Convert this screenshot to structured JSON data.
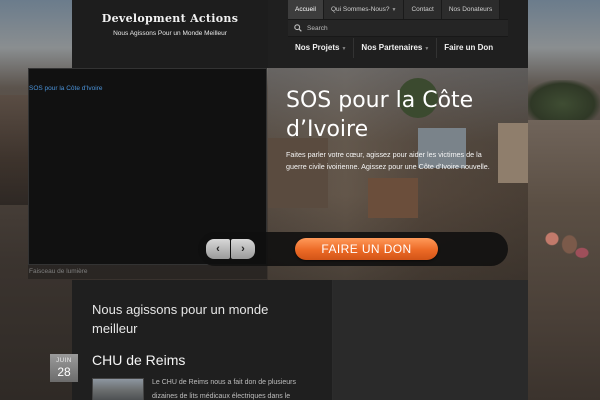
{
  "site": {
    "title": "Development Actions",
    "tagline": "Nous Agissons Pour un Monde Meilleur"
  },
  "top_menu": {
    "items": [
      {
        "label": "Accueil",
        "active": true
      },
      {
        "label": "Qui Sommes-Nous?",
        "has_submenu": true
      },
      {
        "label": "Contact"
      },
      {
        "label": "Nos Donateurs"
      }
    ]
  },
  "search": {
    "placeholder": "Search",
    "icon": "search-icon"
  },
  "main_menu": {
    "items": [
      {
        "label": "Nos Projets",
        "has_submenu": true
      },
      {
        "label": "Nos Partenaires",
        "has_submenu": true
      },
      {
        "label": "Faire un Don"
      }
    ]
  },
  "slider": {
    "left_image_alt": "SOS pour la Côte d'Ivoire",
    "title": "SOS pour la Côte d’Ivoire",
    "text": "Faites parler votre cœur, agissez pour aider les victimes de la guerre civile ivoirienne. Agissez pour une Côte d’Ivoire nouvelle.",
    "prev_label": "‹",
    "next_label": "›",
    "donate_label": "FAIRE UN DON",
    "caption": "Faisceau de lumière",
    "accent_color": "#ec6a26"
  },
  "content": {
    "section_title": "Nous agissons pour un monde meilleur",
    "post": {
      "month": "JUIN",
      "day": "28",
      "title": "CHU de Reims",
      "excerpt": "Le CHU de Reims nous a fait don de plusieurs dizaines de lits médicaux électriques dans le"
    }
  }
}
